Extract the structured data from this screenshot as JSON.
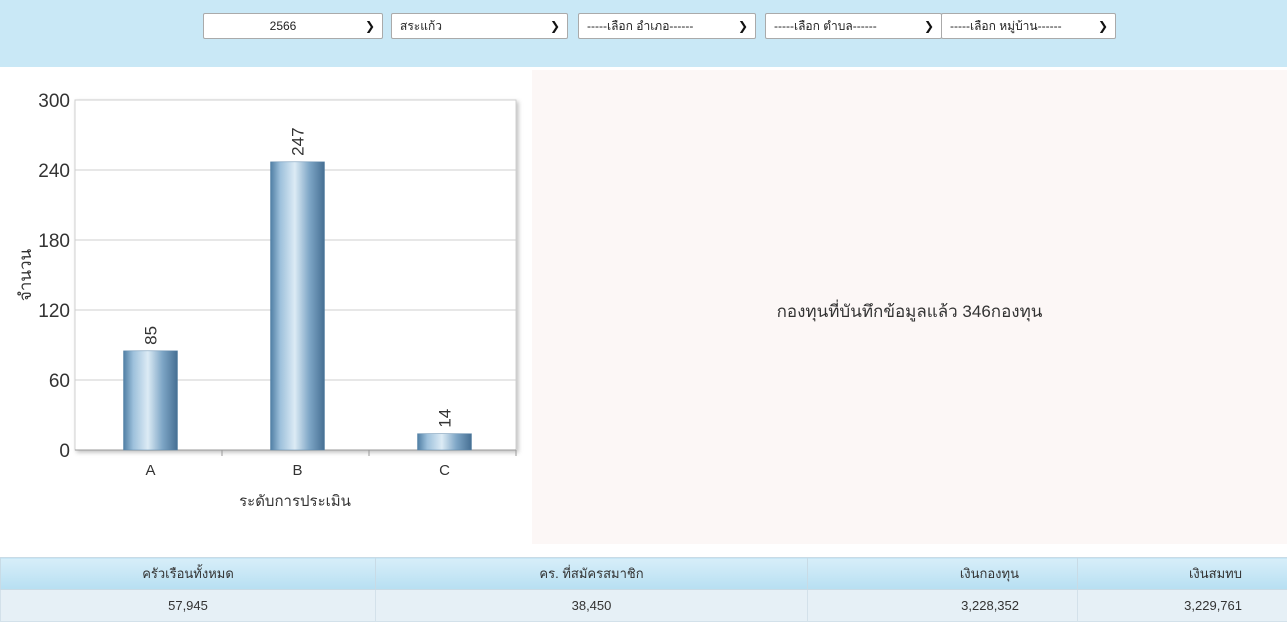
{
  "filters": {
    "year": "2566",
    "province": "สระแก้ว",
    "district": "-----เลือก อำเภอ------",
    "subdistrict": "-----เลือก ตำบล------",
    "village": "-----เลือก หมู่บ้าน------"
  },
  "icons": {
    "dropdown": "chevron-down-icon"
  },
  "chart_data": {
    "type": "bar",
    "categories": [
      "A",
      "B",
      "C"
    ],
    "values": [
      85,
      247,
      14
    ],
    "title": "",
    "xlabel": "ระดับการประเมิน",
    "ylabel": "จำนวน",
    "ylim": [
      0,
      300
    ],
    "yticks": [
      0,
      60,
      120,
      180,
      240,
      300
    ],
    "grid": true,
    "legend": "none",
    "bar_color": "#6f98b8"
  },
  "info": {
    "message": "กองทุนที่บันทึกข้อมูลแล้ว 346กองทุน"
  },
  "summary": {
    "headers": [
      "ครัวเรือนทั้งหมด",
      "คร. ที่สมัครสมาชิก",
      "เงินกองทุน",
      "เงินสมทบ"
    ],
    "values": [
      "57,945",
      "38,450",
      "3,228,352",
      "3,229,761"
    ]
  }
}
